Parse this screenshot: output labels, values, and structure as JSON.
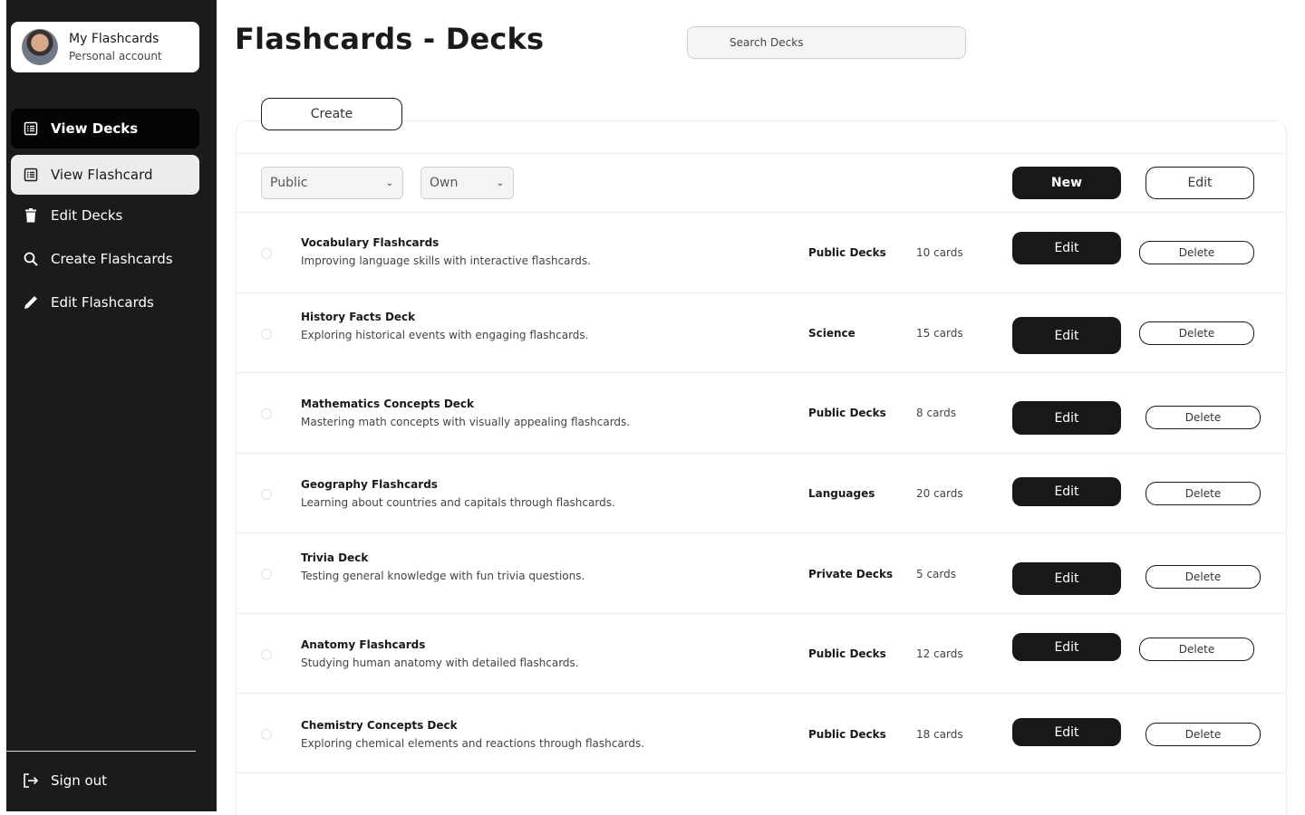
{
  "profile": {
    "name": "My Flashcards",
    "subtitle": "Personal account"
  },
  "nav": {
    "items": [
      {
        "label": "View Decks",
        "icon": "list-icon"
      },
      {
        "label": "View Flashcard",
        "icon": "list-icon"
      },
      {
        "label": "Edit Decks",
        "icon": "trash-icon"
      },
      {
        "label": "Create Flashcards",
        "icon": "search-icon"
      },
      {
        "label": "Edit Flashcards",
        "icon": "pencil-icon"
      }
    ],
    "signout": "Sign out"
  },
  "header": {
    "title": "Flashcards - Decks",
    "search_placeholder": "Search Decks"
  },
  "toolbar": {
    "create_label": "Create",
    "filter_visibility": "Public",
    "filter_owner": "Own",
    "new_label": "New",
    "edit_label": "Edit"
  },
  "decks": [
    {
      "title": "Vocabulary Flashcards",
      "description": "Improving language skills with interactive flashcards.",
      "category": "Public Decks",
      "count": "10 cards",
      "edit": "Edit",
      "delete": "Delete"
    },
    {
      "title": "History Facts Deck",
      "description": "Exploring historical events with engaging flashcards.",
      "category": "Science",
      "count": "15 cards",
      "edit": "Edit",
      "delete": "Delete"
    },
    {
      "title": "Mathematics Concepts Deck",
      "description": "Mastering math concepts with visually appealing flashcards.",
      "category": "Public Decks",
      "count": "8 cards",
      "edit": "Edit",
      "delete": "Delete"
    },
    {
      "title": "Geography Flashcards",
      "description": "Learning about countries and capitals through flashcards.",
      "category": "Languages",
      "count": "20 cards",
      "edit": "Edit",
      "delete": "Delete"
    },
    {
      "title": "Trivia Deck",
      "description": "Testing general knowledge with fun trivia questions.",
      "category": "Private Decks",
      "count": "5 cards",
      "edit": "Edit",
      "delete": "Delete"
    },
    {
      "title": "Anatomy Flashcards",
      "description": "Studying human anatomy with detailed flashcards.",
      "category": "Public Decks",
      "count": "12 cards",
      "edit": "Edit",
      "delete": "Delete"
    },
    {
      "title": "Chemistry Concepts Deck",
      "description": "Exploring chemical elements and reactions through flashcards.",
      "category": "Public Decks",
      "count": "18 cards",
      "edit": "Edit",
      "delete": "Delete"
    }
  ]
}
